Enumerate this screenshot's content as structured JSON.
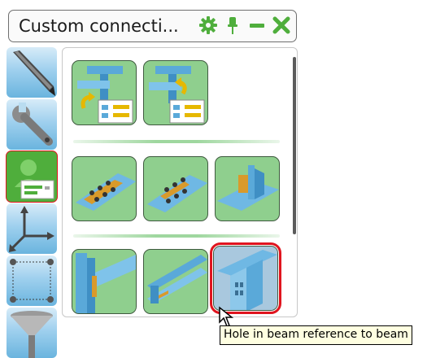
{
  "window": {
    "title": "Custom connecti...",
    "icons": [
      "gear-icon",
      "pin-icon",
      "minimize-icon",
      "close-icon"
    ],
    "accent_color": "#4fae3c"
  },
  "toolbar": {
    "items": [
      {
        "name": "pen-tool",
        "icon": "pen-icon"
      },
      {
        "name": "wrench-tool",
        "icon": "wrench-icon"
      },
      {
        "name": "user-component-tool",
        "icon": "user-component-icon",
        "active": true
      },
      {
        "name": "axes-tool",
        "icon": "axes-icon"
      },
      {
        "name": "grid-tool",
        "icon": "grid-plane-icon"
      },
      {
        "name": "filter-tool",
        "icon": "funnel-icon"
      }
    ],
    "active_outline_color": "#e0141e"
  },
  "palette": {
    "groups": [
      {
        "items": [
          "beam-to-column-connection-1",
          "beam-to-column-connection-2"
        ]
      },
      {
        "items": [
          "plate-bolts-connection-1",
          "plate-bolts-connection-2",
          "plate-stiffener-connection"
        ]
      },
      {
        "items": [
          "column-beam-connection",
          "beam-seat-connection",
          "hole-in-beam-connection"
        ]
      }
    ],
    "selected_item": "hole-in-beam-connection",
    "tile_color": "#8fcf8e"
  },
  "tooltip": {
    "text": "Hole in beam reference to beam"
  }
}
